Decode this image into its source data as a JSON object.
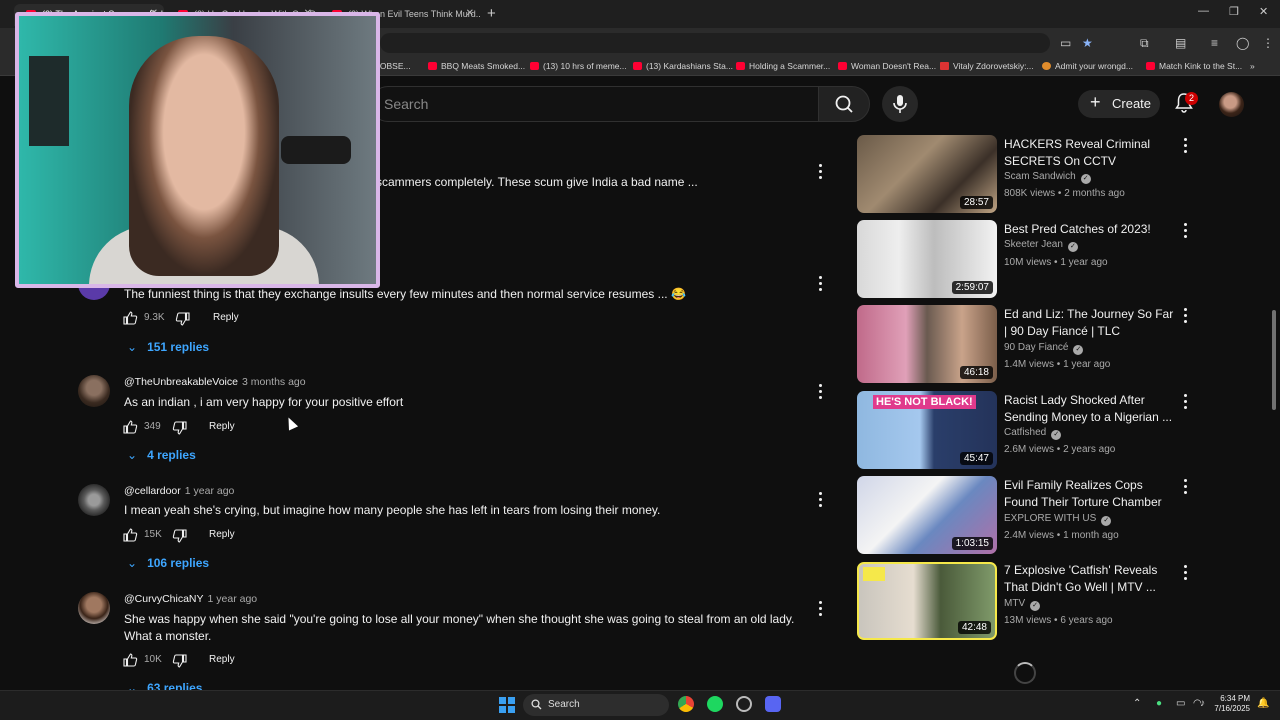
{
  "browser": {
    "tabs": [
      {
        "title": "(2) The Angriest Scammer Rel..."
      },
      {
        "title": "(2) He Got Handsy With Our D..."
      },
      {
        "title": "(2) When Evil Teens Think Murd..."
      }
    ],
    "new_tab_label": "+",
    "bookmarks": [
      {
        "label": "Y OBSE..."
      },
      {
        "label": "BBQ Meats Smoked..."
      },
      {
        "label": "(13) 10 hrs of meme..."
      },
      {
        "label": "(13) Kardashians Sta..."
      },
      {
        "label": "Holding a Scammer..."
      },
      {
        "label": "Woman Doesn't Rea..."
      },
      {
        "label": "Vitaly Zdorovetskiy:..."
      },
      {
        "label": "Admit your wrongd..."
      },
      {
        "label": "Match Kink to the St..."
      }
    ]
  },
  "header": {
    "search_placeholder": "Search",
    "create_label": "Create",
    "notification_count": "2"
  },
  "comments": {
    "partial_top_text": "scammers completely. These scum give India a bad name ...",
    "items": [
      {
        "author": "",
        "time": "",
        "text": "The funniest thing is that they exchange insults every few minutes and then normal service resumes ... 😂",
        "likes": "9.3K",
        "reply_label": "Reply",
        "replies": "151 replies"
      },
      {
        "author": "@TheUnbreakableVoice",
        "time": "3 months ago",
        "text": "As an indian , i am very happy for your positive effort",
        "likes": "349",
        "reply_label": "Reply",
        "replies": "4 replies"
      },
      {
        "author": "@cellardoor",
        "time": "1 year ago",
        "text": "I mean yeah she's crying, but imagine how many people she has left in tears from losing their money.",
        "likes": "15K",
        "reply_label": "Reply",
        "replies": "106 replies"
      },
      {
        "author": "@CurvyChicaNY",
        "time": "1 year ago",
        "text": "She was happy when she said \"you're going to lose all your money\" when she thought she was going to steal from an old lady. What a monster.",
        "likes": "10K",
        "reply_label": "Reply",
        "replies": "63 replies"
      }
    ]
  },
  "recommendations": [
    {
      "title": "HACKERS Reveal Criminal SECRETS On CCTV",
      "channel": "Scam Sandwich",
      "views": "808K views",
      "age": "2 months ago",
      "duration": "28:57",
      "verified": true
    },
    {
      "title": "Best Pred Catches of 2023!",
      "channel": "Skeeter Jean",
      "views": "10M views",
      "age": "1 year ago",
      "duration": "2:59:07",
      "verified": true
    },
    {
      "title": "Ed and Liz: The Journey So Far | 90 Day Fiancé | TLC",
      "channel": "90 Day Fiancé",
      "views": "1.4M views",
      "age": "1 year ago",
      "duration": "46:18",
      "verified": true
    },
    {
      "title": "Racist Lady Shocked After Sending Money to a Nigerian ...",
      "channel": "Catfished",
      "views": "2.6M views",
      "age": "2 years ago",
      "duration": "45:47",
      "verified": true,
      "thumb_text": "HE'S NOT BLACK!"
    },
    {
      "title": "Evil Family Realizes Cops Found Their Torture Chamber",
      "channel": "EXPLORE WITH US",
      "views": "2.4M views",
      "age": "1 month ago",
      "duration": "1:03:15",
      "verified": true
    },
    {
      "title": "7 Explosive 'Catfish' Reveals That Didn't Go Well | MTV ...",
      "channel": "MTV",
      "views": "13M views",
      "age": "6 years ago",
      "duration": "42:48",
      "verified": true
    }
  ],
  "taskbar": {
    "search_label": "Search",
    "time": "6:34 PM",
    "date": "7/16/2025"
  },
  "colors": {
    "background": "#0f0f0f",
    "link_blue": "#3ea6ff",
    "youtube_red": "#ff0033",
    "webcam_border": "#d9b7e8"
  }
}
